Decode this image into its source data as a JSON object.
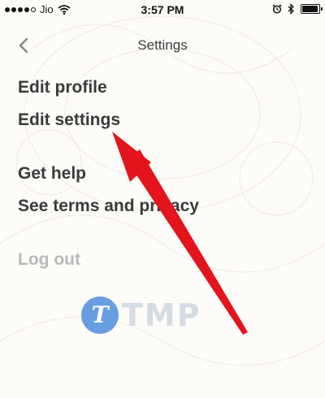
{
  "status_bar": {
    "signal_filled": 4,
    "signal_total": 5,
    "carrier": "Jio",
    "time": "3:57 PM",
    "battery_level": 0.85
  },
  "nav": {
    "title": "Settings",
    "back_icon": "chevron-left-icon"
  },
  "menu": {
    "edit_profile": "Edit profile",
    "edit_settings": "Edit settings",
    "get_help": "Get help",
    "terms": "See terms and privacy",
    "log_out": "Log out"
  },
  "watermark": {
    "logo_letter": "T",
    "text": "TMP"
  },
  "colors": {
    "arrow": "#e3141c",
    "text": "#3a3a3a",
    "disabled": "#b8b8b8",
    "watermark_blue": "#4f8edc"
  }
}
